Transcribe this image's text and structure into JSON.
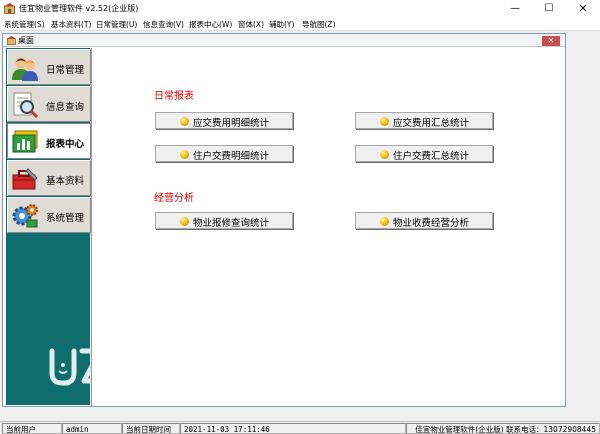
{
  "window": {
    "title": "佳宜物业管理软件 v2.52(企业版)",
    "minimize": "—",
    "maximize": "☐",
    "close": "✕"
  },
  "menu": [
    "系统管理(S)",
    "基本资料(T)",
    "日常管理(U)",
    "信息查询(V)",
    "报表中心(W)",
    "窗体(X)",
    "辅助(Y)",
    "导航图(Z)"
  ],
  "child_window": {
    "title": "桌面",
    "close": "✕"
  },
  "sidebar": {
    "items": [
      {
        "label": "日常管理",
        "icon": "people-icon",
        "active": false
      },
      {
        "label": "信息查询",
        "icon": "magnifier-icon",
        "active": false
      },
      {
        "label": "报表中心",
        "icon": "report-icon",
        "active": true
      },
      {
        "label": "基本资料",
        "icon": "toolbox-icon",
        "active": false
      },
      {
        "label": "系统管理",
        "icon": "gear-icon",
        "active": false
      }
    ],
    "logo_icon": "brand-logo-icon"
  },
  "sections": [
    {
      "heading": "日常报表",
      "buttons": [
        "应交费用明细统计",
        "应交费用汇总统计",
        "住户交费明细统计",
        "住户交费汇总统计"
      ]
    },
    {
      "heading": "经营分析",
      "buttons": [
        "物业报修查询统计",
        "物业收费经营分析"
      ]
    }
  ],
  "statusbar": {
    "user_label": "当前用户",
    "user": "admin",
    "date_label": "当前日期时间",
    "datetime": "2021-11-03 17:11:46",
    "app_info": "佳宜物业管理软件(企业版) 联系电话：13072908445"
  },
  "colors": {
    "sidebar_bg": "#0f6e6d",
    "section_heading": "#e00000",
    "button_dot": "#f4c21a"
  }
}
